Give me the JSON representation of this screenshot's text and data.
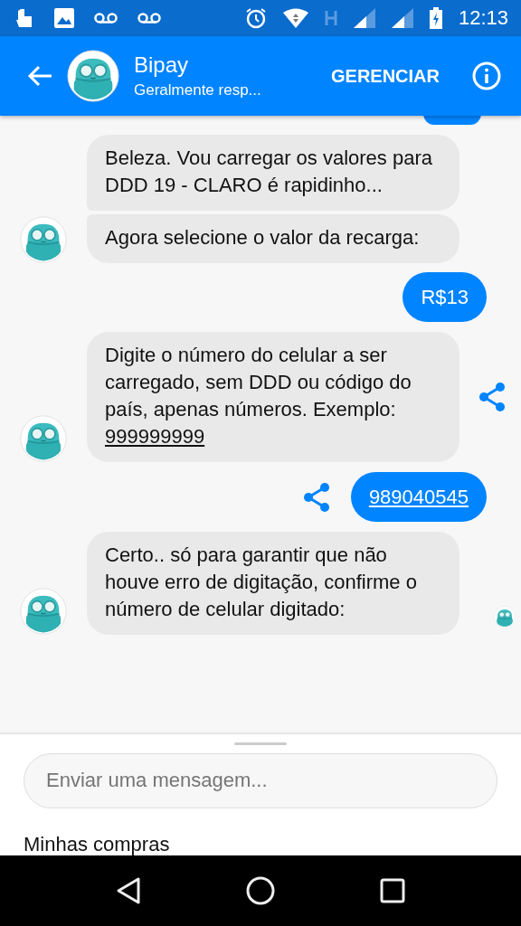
{
  "status_bar": {
    "time": "12:13"
  },
  "header": {
    "title": "Bipay",
    "subtitle": "Geralmente resp...",
    "action": "GERENCIAR"
  },
  "messages": [
    {
      "kind": "partial_bubble"
    },
    {
      "kind": "bot",
      "share": false,
      "bubbles": [
        {
          "text": "Beleza. Vou carregar os valores para DDD 19 - CLARO é rapidinho..."
        },
        {
          "text": "Agora selecione o valor da recarga:"
        }
      ]
    },
    {
      "kind": "user",
      "share": false,
      "text": "R$13",
      "underline": false
    },
    {
      "kind": "bot",
      "share": true,
      "bubbles": [
        {
          "text": "Digite o número do celular a ser carregado, sem DDD ou código do país, apenas números. Exemplo: ",
          "link": "999999999"
        }
      ]
    },
    {
      "kind": "user",
      "share": true,
      "text": "989040545",
      "underline": true
    },
    {
      "kind": "bot",
      "share": false,
      "seen": true,
      "bubbles": [
        {
          "text": "Certo.. só para garantir que não houve erro de digitação, confirme o número de celular digitado:"
        }
      ]
    }
  ],
  "composer": {
    "placeholder": "Enviar uma mensagem...",
    "menu_item": "Minhas compras"
  }
}
